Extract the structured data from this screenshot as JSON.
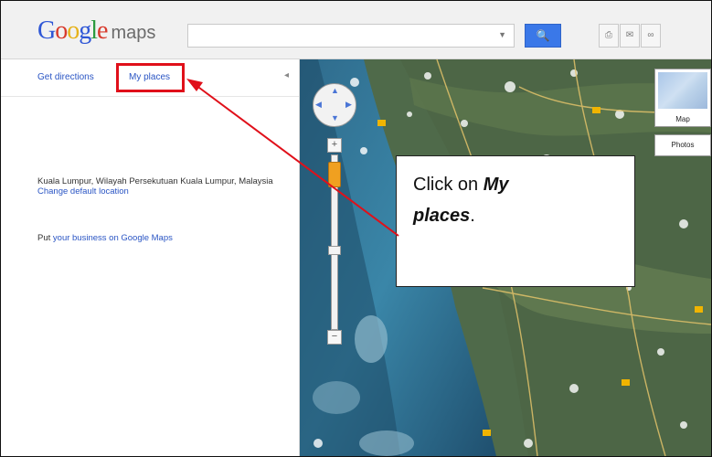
{
  "app": {
    "logo_google": "Google",
    "logo_maps": "maps"
  },
  "search": {
    "value": "",
    "dropdown_icon": "chevron-down-icon",
    "button_icon": "search-icon"
  },
  "toolbar": {
    "icons": [
      "print-icon",
      "mail-icon",
      "link-icon"
    ]
  },
  "sidebar": {
    "tabs": [
      {
        "label": "Get directions"
      },
      {
        "label": "My places"
      }
    ],
    "collapse_icon": "chevron-left-icon",
    "location": {
      "text": "Kuala Lumpur, Wilayah Persekutuan Kuala Lumpur, Malaysia",
      "change_link": "Change default location"
    },
    "business": {
      "prefix": "Put",
      "link": "your business on Google Maps"
    }
  },
  "map": {
    "zoom_plus": "+",
    "zoom_minus": "−",
    "map_type_label": "Map",
    "photos_label": "Photos"
  },
  "annotation": {
    "text_prefix": "Click on ",
    "emphasis_1": "My",
    "emphasis_2": "places",
    "suffix": ".",
    "box_color": "#e0101a"
  }
}
